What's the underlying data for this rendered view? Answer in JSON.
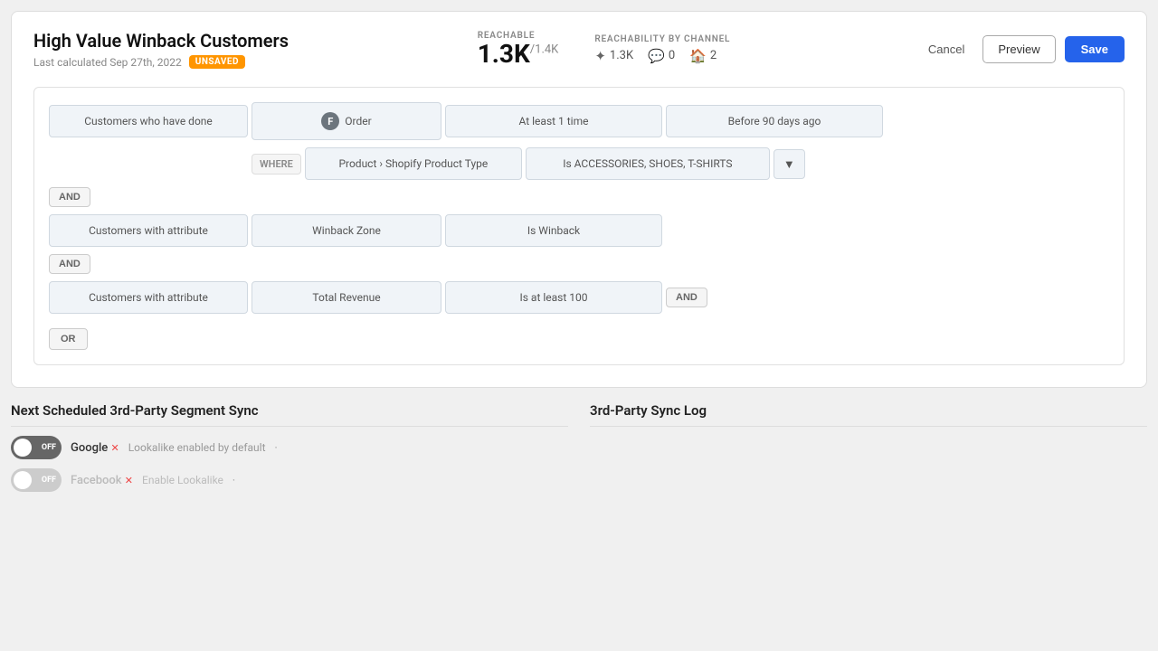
{
  "page": {
    "title": "High Value Winback Customers",
    "last_calculated": "Last calculated Sep 27th, 2022",
    "unsaved_label": "UNSAVED",
    "reachable_label": "REACHABLE",
    "reachable_value": "1.3K",
    "reachable_sub": "/1.4K",
    "reachability_label": "REACHABILITY BY CHANNEL",
    "channels": [
      {
        "icon": "✦",
        "value": "1.3K"
      },
      {
        "icon": "💬",
        "value": "0"
      },
      {
        "icon": "🏠",
        "value": "2"
      }
    ],
    "btn_cancel": "Cancel",
    "btn_preview": "Preview",
    "btn_save": "Save"
  },
  "segment": {
    "row1": {
      "type": "Customers who have done",
      "event": "Order",
      "frequency": "At least 1 time",
      "time": "Before 90 days ago"
    },
    "where": {
      "label": "WHERE",
      "attribute": "Product › Shopify Product Type",
      "value": "Is ACCESSORIES, SHOES, T-SHIRTS",
      "filter_icon": "▼"
    },
    "and1_label": "AND",
    "row2": {
      "type": "Customers with attribute",
      "attr_name": "Winback Zone",
      "attr_value": "Is Winback"
    },
    "and2_label": "AND",
    "row3": {
      "type": "Customers with attribute",
      "attr_name": "Total Revenue",
      "attr_value": "Is at least 100",
      "extra_btn": "AND"
    },
    "or_label": "OR"
  },
  "bottom": {
    "sync_title": "Next Scheduled 3rd-Party Segment Sync",
    "log_title": "3rd-Party Sync Log",
    "sync_items": [
      {
        "enabled": true,
        "label": "Google",
        "has_x": true,
        "lookalike": "Lookalike enabled by default",
        "lookalike_dash": "·",
        "disabled": false
      },
      {
        "enabled": false,
        "label": "Facebook",
        "has_x": true,
        "lookalike": "Enable Lookalike",
        "lookalike_dash": "·",
        "disabled": true
      }
    ]
  }
}
